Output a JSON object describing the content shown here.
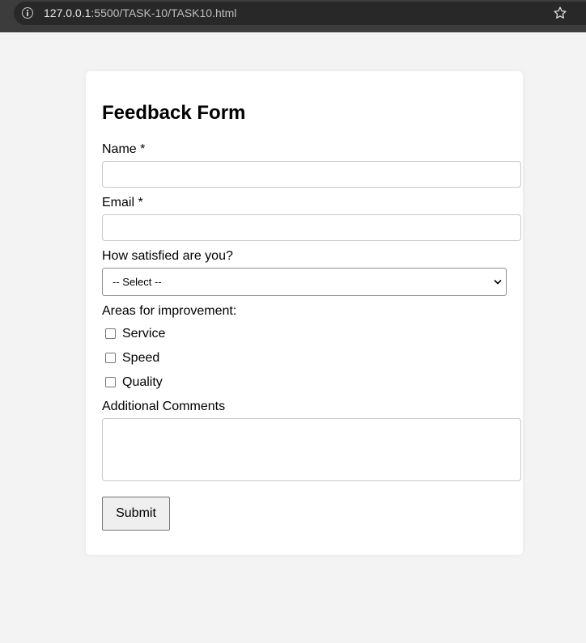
{
  "browser": {
    "url_host": "127.0.0.1",
    "url_rest": ":5500/TASK-10/TASK10.html",
    "info_icon": "info-icon",
    "bookmark_icon": "star-icon"
  },
  "form": {
    "title": "Feedback Form",
    "name_label": "Name *",
    "name_value": "",
    "email_label": "Email *",
    "email_value": "",
    "satisfaction_label": "How satisfied are you?",
    "satisfaction_selected": "-- Select --",
    "improvement_label": "Areas for improvement:",
    "improvement_options": [
      {
        "label": "Service",
        "checked": false
      },
      {
        "label": "Speed",
        "checked": false
      },
      {
        "label": "Quality",
        "checked": false
      }
    ],
    "comments_label": "Additional Comments",
    "comments_value": "",
    "submit_label": "Submit"
  },
  "colors": {
    "page_background": "#f3f3f3",
    "card_background": "#ffffff",
    "browser_bar": "#3c3c3c"
  }
}
